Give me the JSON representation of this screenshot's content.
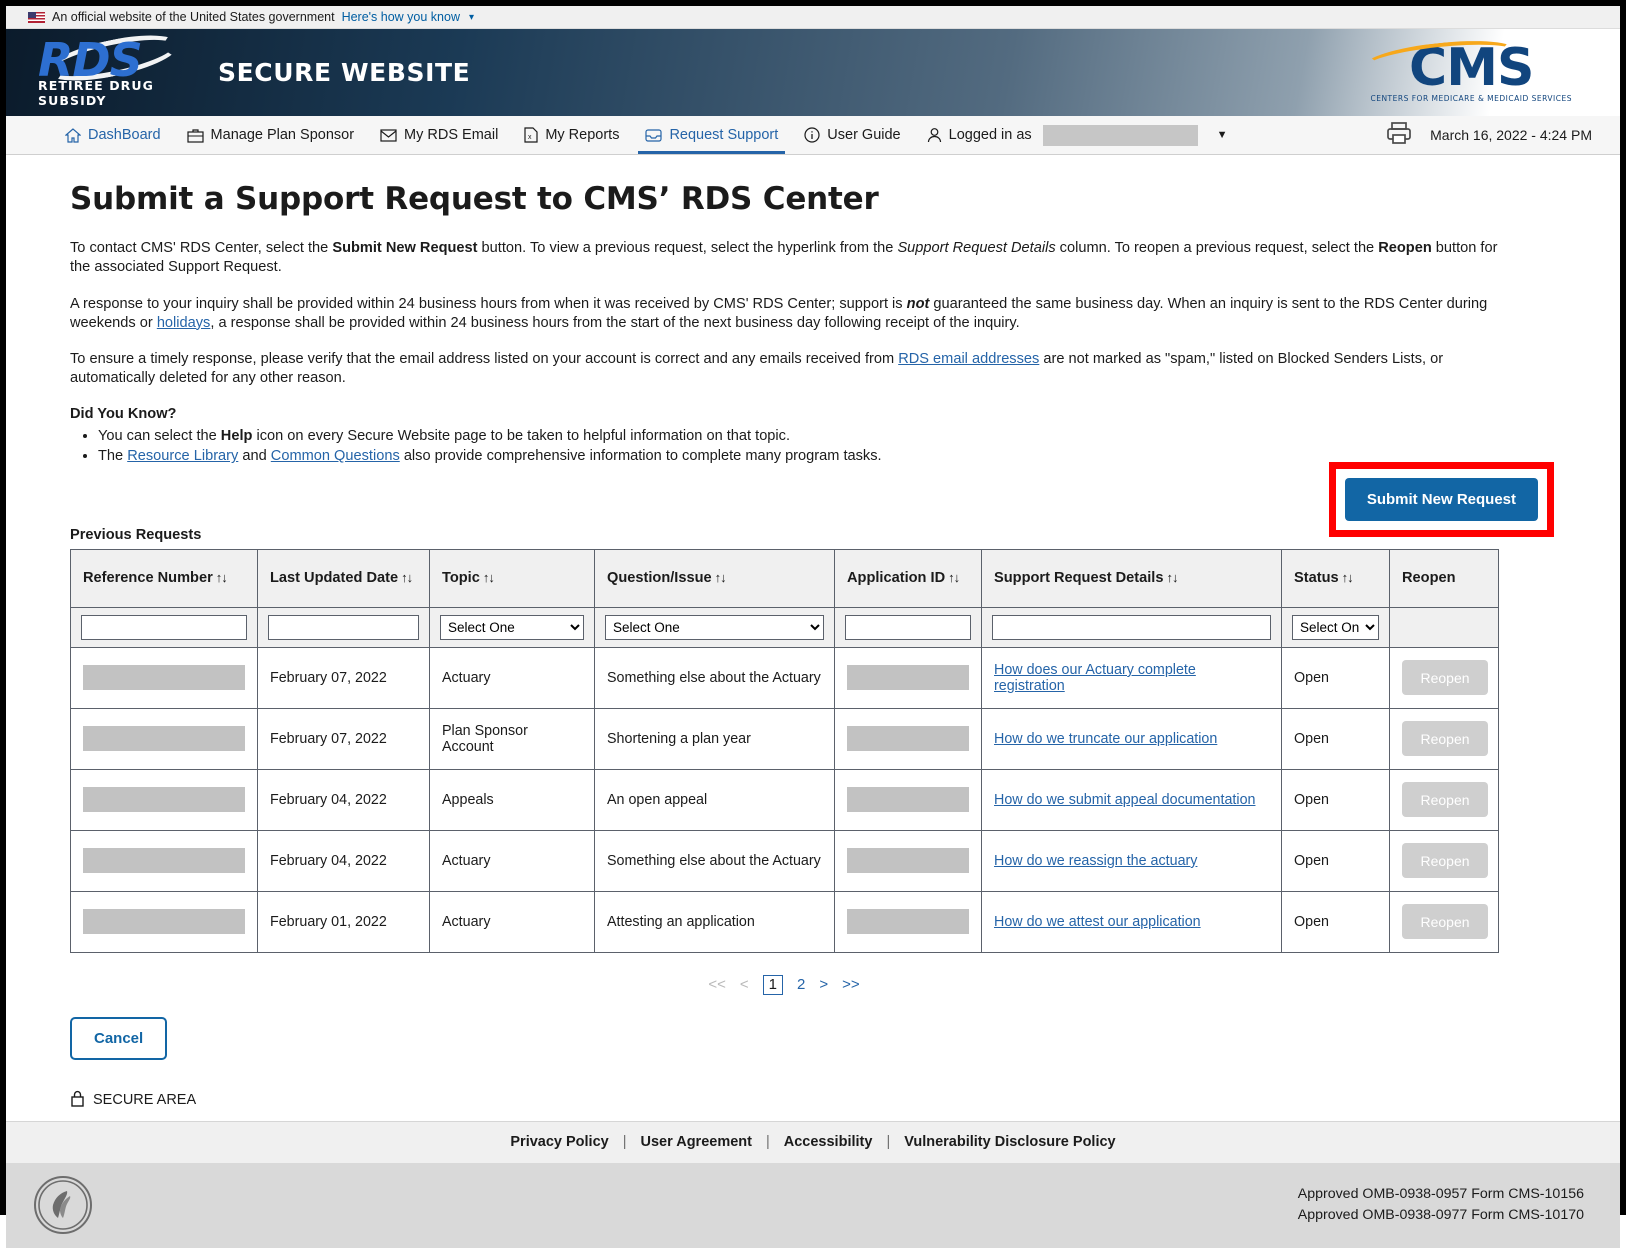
{
  "banner": {
    "text": "An official website of the United States government",
    "link": "Here's how you know",
    "flag_icon": "us-flag-icon",
    "caret_icon": "chevron-down-icon"
  },
  "masthead": {
    "logo_word": "RDS",
    "logo_sub": "RETIREE DRUG SUBSIDY",
    "site_title": "SECURE WEBSITE",
    "cms_word": "CMS",
    "cms_sub": "CENTERS FOR MEDICARE & MEDICAID SERVICES"
  },
  "nav": {
    "items": [
      {
        "label": "DashBoard",
        "icon": "home-icon",
        "style": "link"
      },
      {
        "label": "Manage Plan Sponsor",
        "icon": "briefcase-icon",
        "style": "plain"
      },
      {
        "label": "My RDS Email",
        "icon": "envelope-icon",
        "style": "plain"
      },
      {
        "label": "My Reports",
        "icon": "report-icon",
        "style": "plain"
      },
      {
        "label": "Request Support",
        "icon": "inbox-icon",
        "style": "active"
      },
      {
        "label": "User Guide",
        "icon": "info-circle-icon",
        "style": "plain"
      },
      {
        "label": "Logged in as",
        "icon": "user-icon",
        "style": "plain"
      }
    ],
    "print_icon": "printer-icon",
    "datetime": "March 16, 2022 - 4:24 PM"
  },
  "main": {
    "title": "Submit a Support Request to CMS’ RDS Center",
    "paragraph1": {
      "a": "To contact CMS' RDS Center, select the ",
      "b_submit": "Submit New Request",
      "c": " button. To view a previous request, select the hyperlink from the ",
      "d_italic": "Support Request Details",
      "e": " column. To reopen a previous request, select the ",
      "f_reopen": "Reopen",
      "g": " button for the associated Support Request."
    },
    "paragraph2": {
      "a": "A response to your inquiry shall be provided within 24 business hours from when it was received by CMS' RDS Center; support is ",
      "b_not": "not",
      "c": " guaranteed the same business day. When an inquiry is sent to the RDS Center during weekends or ",
      "d_link": "holidays",
      "e": ", a response shall be provided within 24 business hours from the start of the next business day following receipt of the inquiry."
    },
    "paragraph3": {
      "a": "To ensure a timely response, please verify that the email address listed on your account is correct and any emails received from ",
      "b_link": "RDS email addresses",
      "c": " are not marked as \"spam,\" listed on Blocked Senders Lists, or automatically deleted for any other reason."
    },
    "did_you_know_heading": "Did You Know?",
    "bullets": [
      {
        "a": "You can select the ",
        "b_bold": "Help",
        "c": " icon on every Secure Website page to be taken to helpful information on that topic."
      },
      {
        "a": "The ",
        "b_link": "Resource Library",
        "c": " and ",
        "d_link": "Common Questions",
        "e": " also provide comprehensive information to complete many program tasks."
      }
    ],
    "previous_requests_label": "Previous Requests",
    "submit_new_request_label": "Submit New Request",
    "highlight_color": "#ff0000",
    "primary_color": "#1266a5",
    "cancel_label": "Cancel"
  },
  "table": {
    "headers": [
      {
        "label": "Reference Number",
        "sortable": true
      },
      {
        "label": "Last Updated Date",
        "sortable": true
      },
      {
        "label": "Topic",
        "sortable": true
      },
      {
        "label": "Question/Issue",
        "sortable": true
      },
      {
        "label": "Application ID",
        "sortable": true
      },
      {
        "label": "Support Request Details",
        "sortable": true
      },
      {
        "label": "Status",
        "sortable": true
      },
      {
        "label": "Reopen",
        "sortable": false
      }
    ],
    "sort_glyph": "↑↓",
    "filters": {
      "reference_number": "",
      "last_updated_date": "",
      "topic": "Select One",
      "question_issue": "Select One",
      "application_id": "",
      "support_request_details": "",
      "status": "Select One"
    },
    "rows": [
      {
        "reference_number": "",
        "last_updated_date": "February 07, 2022",
        "topic": "Actuary",
        "question_issue": "Something else about the Actuary",
        "application_id": "",
        "support_request_details": "How does our Actuary complete registration",
        "status": "Open",
        "reopen_label": "Reopen"
      },
      {
        "reference_number": "",
        "last_updated_date": "February 07, 2022",
        "topic": "Plan Sponsor Account",
        "question_issue": "Shortening a plan year",
        "application_id": "",
        "support_request_details": "How do we truncate our application",
        "status": "Open",
        "reopen_label": "Reopen"
      },
      {
        "reference_number": "",
        "last_updated_date": "February 04, 2022",
        "topic": "Appeals",
        "question_issue": "An open appeal",
        "application_id": "",
        "support_request_details": "How do we submit appeal documentation",
        "status": "Open",
        "reopen_label": "Reopen"
      },
      {
        "reference_number": "",
        "last_updated_date": "February 04, 2022",
        "topic": "Actuary",
        "question_issue": "Something else about the Actuary",
        "application_id": "",
        "support_request_details": "How do we reassign the actuary",
        "status": "Open",
        "reopen_label": "Reopen"
      },
      {
        "reference_number": "",
        "last_updated_date": "February 01, 2022",
        "topic": "Actuary",
        "question_issue": "Attesting an application",
        "application_id": "",
        "support_request_details": "How do we attest our application",
        "status": "Open",
        "reopen_label": "Reopen"
      }
    ]
  },
  "pagination": {
    "first": "<<",
    "prev": "<",
    "pages": [
      "1",
      "2"
    ],
    "current_page": "1",
    "next": ">",
    "last": ">>"
  },
  "secure_area": {
    "label": "SECURE AREA",
    "icon": "lock-icon"
  },
  "footer": {
    "links": [
      "Privacy Policy",
      "User Agreement",
      "Accessibility",
      "Vulnerability Disclosure Policy"
    ],
    "separator": "|",
    "seal_icon": "hhs-seal-icon",
    "omb_lines": [
      "Approved OMB-0938-0957 Form CMS-10156",
      "Approved OMB-0938-0977 Form CMS-10170"
    ]
  }
}
